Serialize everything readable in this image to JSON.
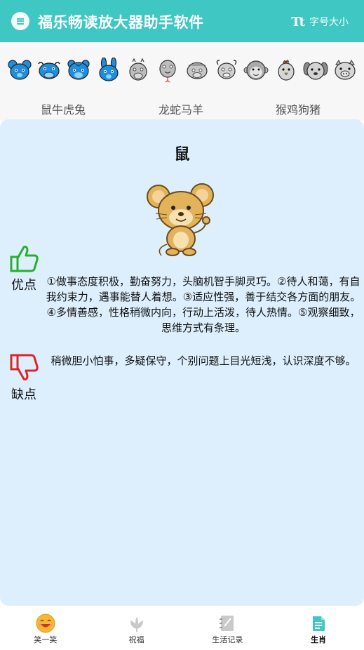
{
  "header": {
    "title": "福乐畅读放大器助手软件",
    "font_size_label": "字号大小",
    "font_size_icon": "Tt"
  },
  "zodiac_strip": {
    "icons": [
      "rat",
      "ox",
      "tiger",
      "rabbit",
      "dragon",
      "snake",
      "horse",
      "goat",
      "monkey",
      "rooster",
      "dog",
      "pig"
    ],
    "groups": [
      "鼠牛虎兔",
      "龙蛇马羊",
      "猴鸡狗猪"
    ]
  },
  "detail": {
    "name": "鼠",
    "pros_label": "优点",
    "pros_text": "①做事态度积极，勤奋努力，头脑机智手脚灵巧。②待人和蔼，有自我约束力，遇事能替人着想。③适应性强，善于结交各方面的朋友。④多情善感，性格稍微内向，行动上活泼，待人热情。⑤观察细致，思维方式有条理。",
    "cons_label": "缺点",
    "cons_text": "稍微胆小怕事，多疑保守，个别问题上目光短浅，认识深度不够。"
  },
  "bottom_nav": {
    "items": [
      {
        "label": "笑一笑",
        "icon": "smile-icon"
      },
      {
        "label": "祝福",
        "icon": "flower-icon"
      },
      {
        "label": "生活记录",
        "icon": "notebook-icon"
      },
      {
        "label": "生肖",
        "icon": "zodiac-book-icon"
      }
    ],
    "active": "生肖"
  },
  "colors": {
    "header_bg": "#3fc7c4",
    "card_bg": "#ddeffd",
    "pros_icon": "#22b32a",
    "cons_icon": "#e02424",
    "blue_icons": "#1c8fe0"
  }
}
